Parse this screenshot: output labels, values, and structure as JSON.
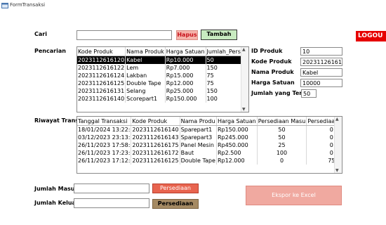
{
  "window": {
    "title": "FormTransaksi"
  },
  "search": {
    "label": "Cari",
    "value": "",
    "hapus_label": "Hapus",
    "tambah_label": "Tambah"
  },
  "logout_label": "LOGOU",
  "pencarian": {
    "label": "Pencarian",
    "columns": [
      "Kode Produk",
      "Nama Produk",
      "Harga Satuan",
      "Jumlah_Persedia"
    ],
    "rows": [
      [
        "2023112616120",
        "Kabel",
        "Rp10.000",
        "50"
      ],
      [
        "2023112616122",
        "Lem",
        "Rp7.000",
        "150"
      ],
      [
        "2023112616124",
        "Lakban",
        "Rp15.000",
        "75"
      ],
      [
        "2023112616125",
        "Double Tape",
        "Rp12.000",
        "75"
      ],
      [
        "2023112616131",
        "Selang",
        "Rp25.000",
        "150"
      ],
      [
        "2023112616140",
        "Scorepart1",
        "Rp150.000",
        "100"
      ]
    ]
  },
  "detail": {
    "id_label": "ID Produk",
    "id_value": "10",
    "kode_label": "Kode Produk",
    "kode_value": "20231126161208",
    "nama_label": "Nama Produk",
    "nama_value": "Kabel",
    "harga_label": "Harga Satuan",
    "harga_value": "10000",
    "jumlah_label": "Jumlah yang Terse",
    "jumlah_value": "50"
  },
  "riwayat": {
    "label": "Riwayat Transak",
    "columns": [
      "Tanggal Transaksi",
      "Kode Produk",
      "Nama Produ",
      "Harga Satuan",
      "Persediaan Masu",
      "Persediaan Keluc"
    ],
    "rows": [
      [
        "18/01/2024 13:22:",
        "2023112616140",
        "Sparepart1",
        "Rp150.000",
        "50",
        "0"
      ],
      [
        "03/12/2023 23:13:",
        "2023112616143",
        "Sparepart3",
        "Rp245.000",
        "50",
        "0"
      ],
      [
        "26/11/2023 17:58:",
        "2023112616175",
        "Panel Mesin",
        "Rp450.000",
        "25",
        "0"
      ],
      [
        "26/11/2023 17:23:",
        "2023112616172",
        "Baut",
        "Rp2.500",
        "100",
        "0"
      ],
      [
        "26/11/2023 17:12:",
        "2023112616125",
        "Double Tape",
        "Rp12.000",
        "0",
        "75"
      ]
    ]
  },
  "masuk": {
    "label": "Jumlah Masuk",
    "value": "",
    "button": "Persediaan"
  },
  "keluar": {
    "label": "Jumlah Keluar",
    "value": "",
    "button": "Persediaan"
  },
  "export_label": "Ekspor ke Excel",
  "colors": {
    "hapus_bg": "#f5b3aa",
    "tambah_bg": "#c8ebc0",
    "logout_bg": "#e60000",
    "persediaan_masuk_bg": "#e8644f",
    "persediaan_keluar_bg": "#a58a63",
    "export_bg": "#f0a9a0",
    "selected_row": "#000000"
  }
}
